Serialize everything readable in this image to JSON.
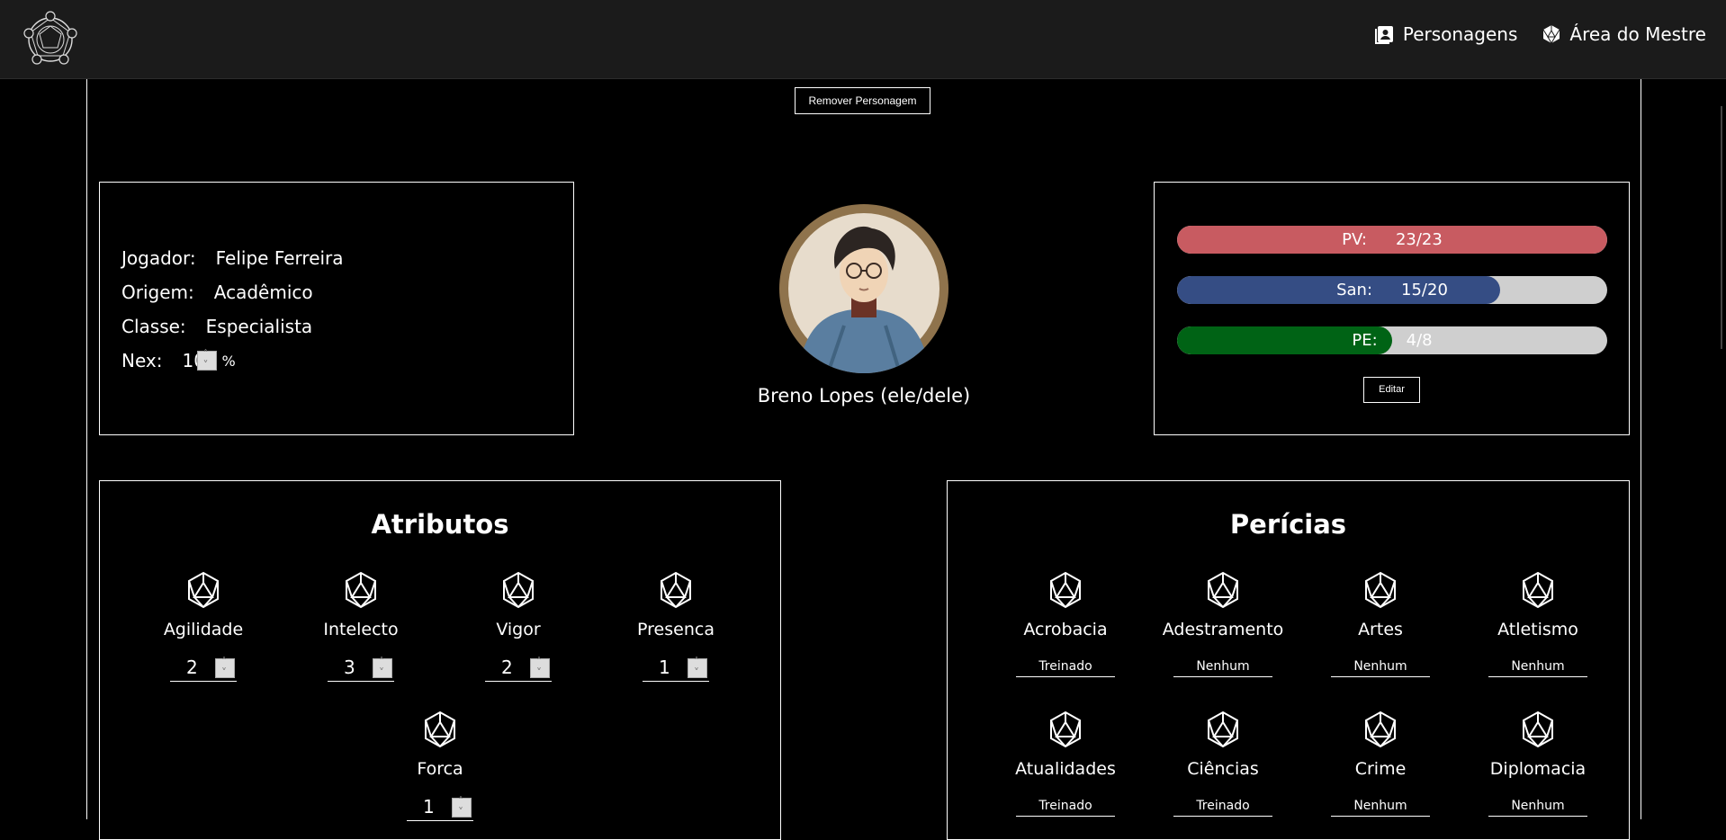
{
  "nav": {
    "characters": "Personagens",
    "master_area": "Área do Mestre"
  },
  "actions": {
    "remove_character": "Remover Personagem",
    "edit": "Editar"
  },
  "info": {
    "player_label": "Jogador:",
    "player": "Felipe Ferreira",
    "origin_label": "Origem:",
    "origin": "Acadêmico",
    "class_label": "Classe:",
    "class": "Especialista",
    "nex_label": "Nex:",
    "nex": "10",
    "nex_unit": "%"
  },
  "character": {
    "name": "Breno Lopes (ele/dele)"
  },
  "stats": {
    "pv_label": "PV:",
    "pv": "23/23",
    "pv_fraction": 1.0,
    "san_label": "San:",
    "san": "15/20",
    "san_fraction": 0.75,
    "pe_label": "PE:",
    "pe": "4/8",
    "pe_fraction": 0.5,
    "colors": {
      "pv": "#c85b61",
      "san": "#354d84",
      "pe": "#006315",
      "track": "#cfcfcf"
    }
  },
  "attributes": {
    "title": "Atributos",
    "items": [
      {
        "label": "Agilidade",
        "value": "2",
        "icon": "d20-icon"
      },
      {
        "label": "Intelecto",
        "value": "3",
        "icon": "d20-icon"
      },
      {
        "label": "Vigor",
        "value": "2",
        "icon": "d20-icon"
      },
      {
        "label": "Presenca",
        "value": "1",
        "icon": "d20-icon"
      },
      {
        "label": "Forca",
        "value": "1",
        "icon": "d20-icon"
      }
    ]
  },
  "skills": {
    "title": "Perícias",
    "items": [
      {
        "label": "Acrobacia",
        "value": "Treinado",
        "icon": "d20-icon"
      },
      {
        "label": "Adestramento",
        "value": "Nenhum",
        "icon": "d20-icon"
      },
      {
        "label": "Artes",
        "value": "Nenhum",
        "icon": "d20-icon"
      },
      {
        "label": "Atletismo",
        "value": "Nenhum",
        "icon": "d20-icon"
      },
      {
        "label": "Atualidades",
        "value": "Treinado",
        "icon": "d20-icon"
      },
      {
        "label": "Ciências",
        "value": "Treinado",
        "icon": "d20-icon"
      },
      {
        "label": "Crime",
        "value": "Nenhum",
        "icon": "d20-icon"
      },
      {
        "label": "Diplomacia",
        "value": "Nenhum",
        "icon": "d20-icon"
      }
    ]
  }
}
